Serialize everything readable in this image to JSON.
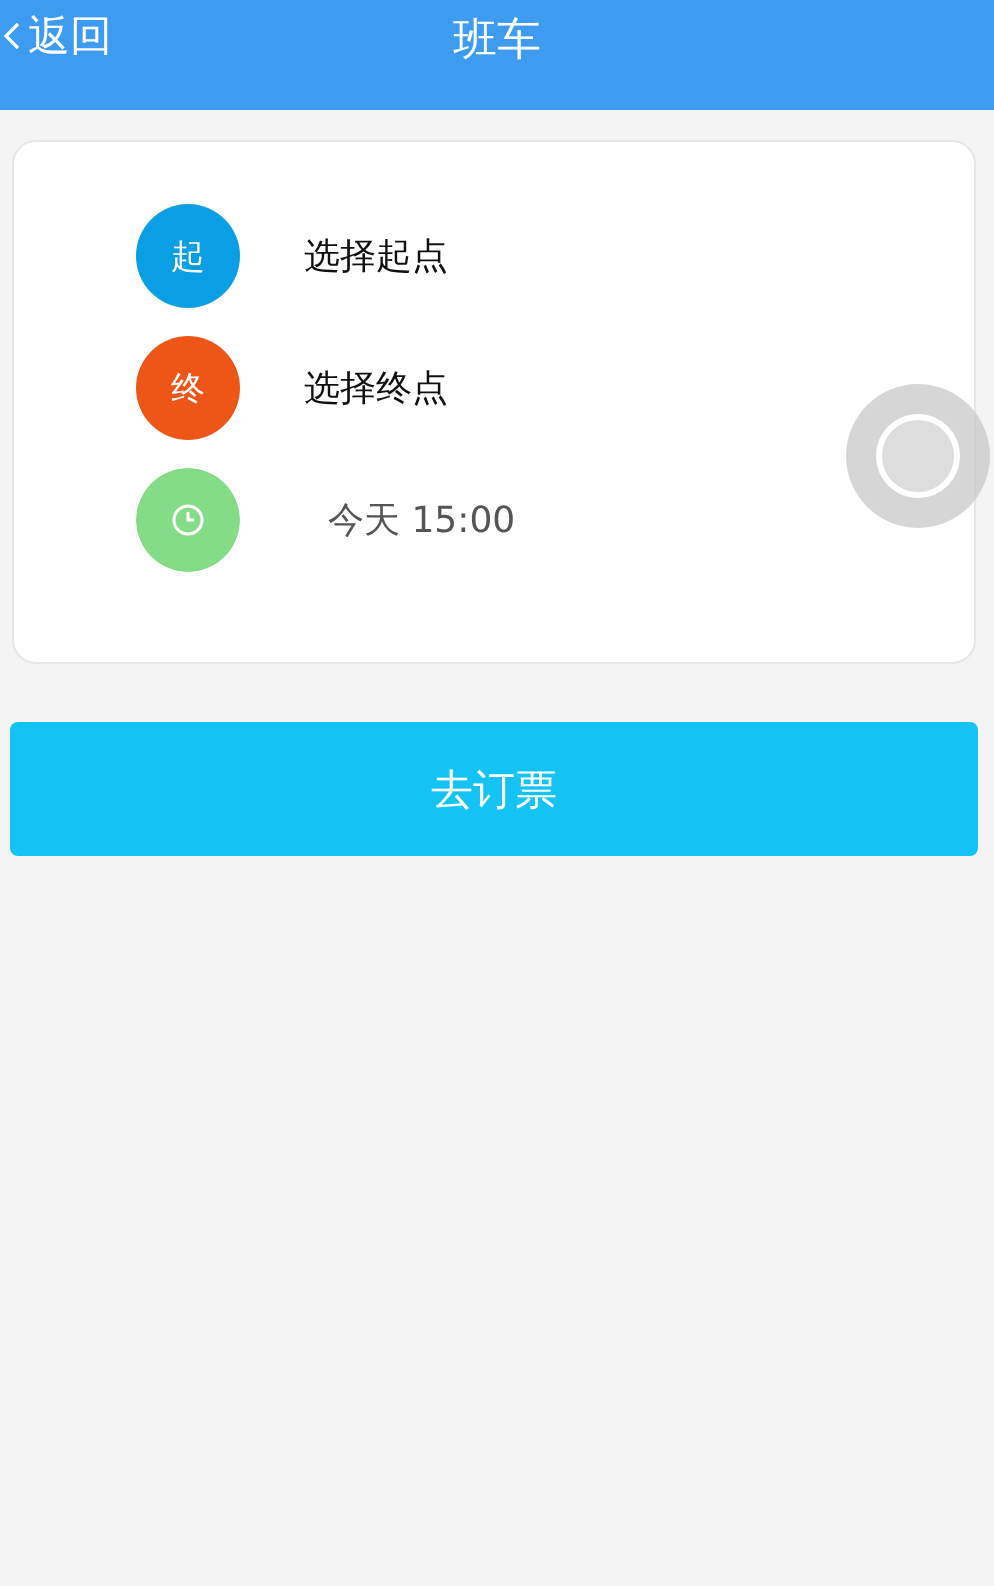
{
  "header": {
    "back_label": "返回",
    "title": "班车"
  },
  "route": [
    {
      "kind": "badge",
      "badge": "起",
      "label": "选择起点",
      "color": "#0a9fe4"
    },
    {
      "kind": "badge",
      "badge": "终",
      "label": "选择终点",
      "color": "#ee5618"
    },
    {
      "kind": "time",
      "label": "今天 15:00",
      "color": "#84dc87"
    }
  ],
  "submit_button": "去订票"
}
